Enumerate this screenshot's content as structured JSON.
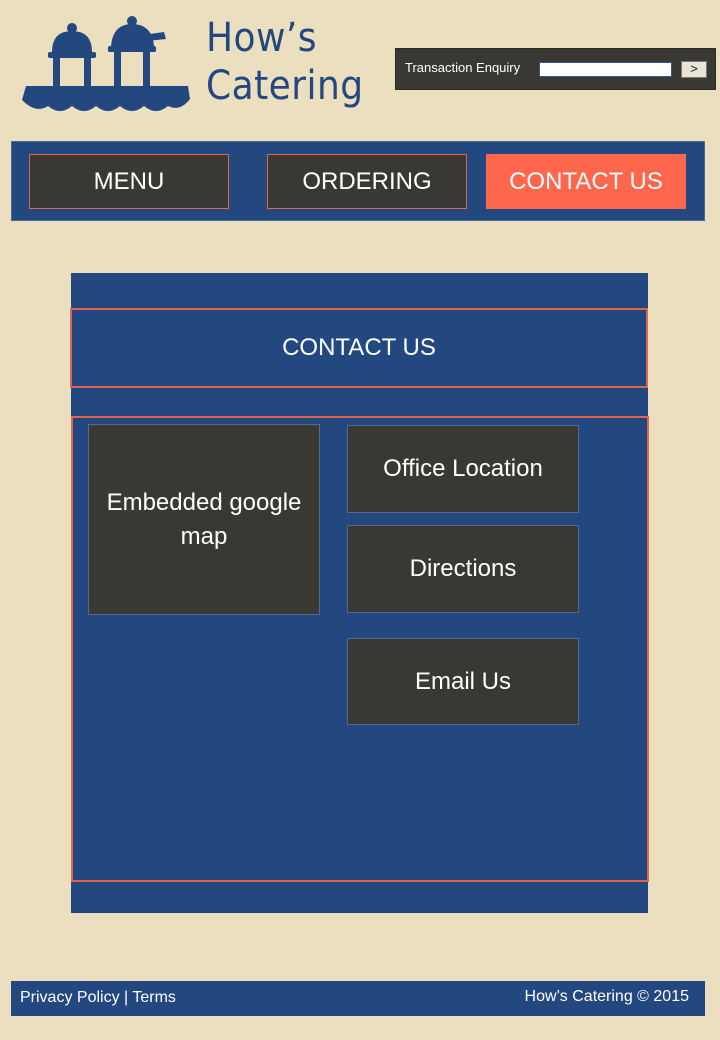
{
  "brand": {
    "line1": "How’s",
    "line2": "Catering"
  },
  "transaction": {
    "label": "Transaction Enquiry",
    "input_value": "",
    "submit_label": ">"
  },
  "nav": {
    "menu": "MENU",
    "ordering": "ORDERING",
    "contact": "CONTACT US",
    "active": "contact"
  },
  "main": {
    "title": "CONTACT US",
    "map_placeholder": "Embedded google map",
    "buttons": [
      "Office Location",
      "Directions",
      "Email Us"
    ]
  },
  "footer": {
    "privacy": "Privacy Policy",
    "separator": " | ",
    "terms": "Terms",
    "copyright": "How’s Catering © 2015"
  },
  "colors": {
    "background": "#ebdfc0",
    "navy": "#23477f",
    "dark": "#3a3833",
    "accent": "#fe674b",
    "outline": "#e2654f"
  },
  "icons": {
    "logo": "catering-cloche-logo-icon"
  }
}
